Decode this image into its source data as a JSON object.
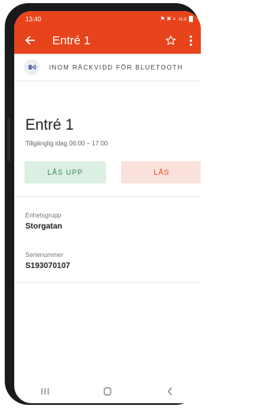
{
  "status_bar": {
    "time": "13:40",
    "signal": "⚑ ✖ ≈ .ıı.ıı"
  },
  "appbar": {
    "title": "Entré 1"
  },
  "bluetooth": {
    "text": "INOM RÄCKVIDD FÖR BLUETOOTH"
  },
  "lock": {
    "name": "Entré 1",
    "availability": "Tillgänglig idag 06:00 – 17:00",
    "unlock_label": "LÅS UPP",
    "lock_label": "LÅS"
  },
  "details": {
    "group_label": "Enhetsgrupp",
    "group_value": "Storgatan",
    "serial_label": "Serienummer",
    "serial_value": "S193070107"
  },
  "colors": {
    "accent": "#e8441c",
    "unlock_bg": "#dcefe3",
    "unlock_text": "#2e8b57",
    "lock_bg": "#fbe1db"
  }
}
